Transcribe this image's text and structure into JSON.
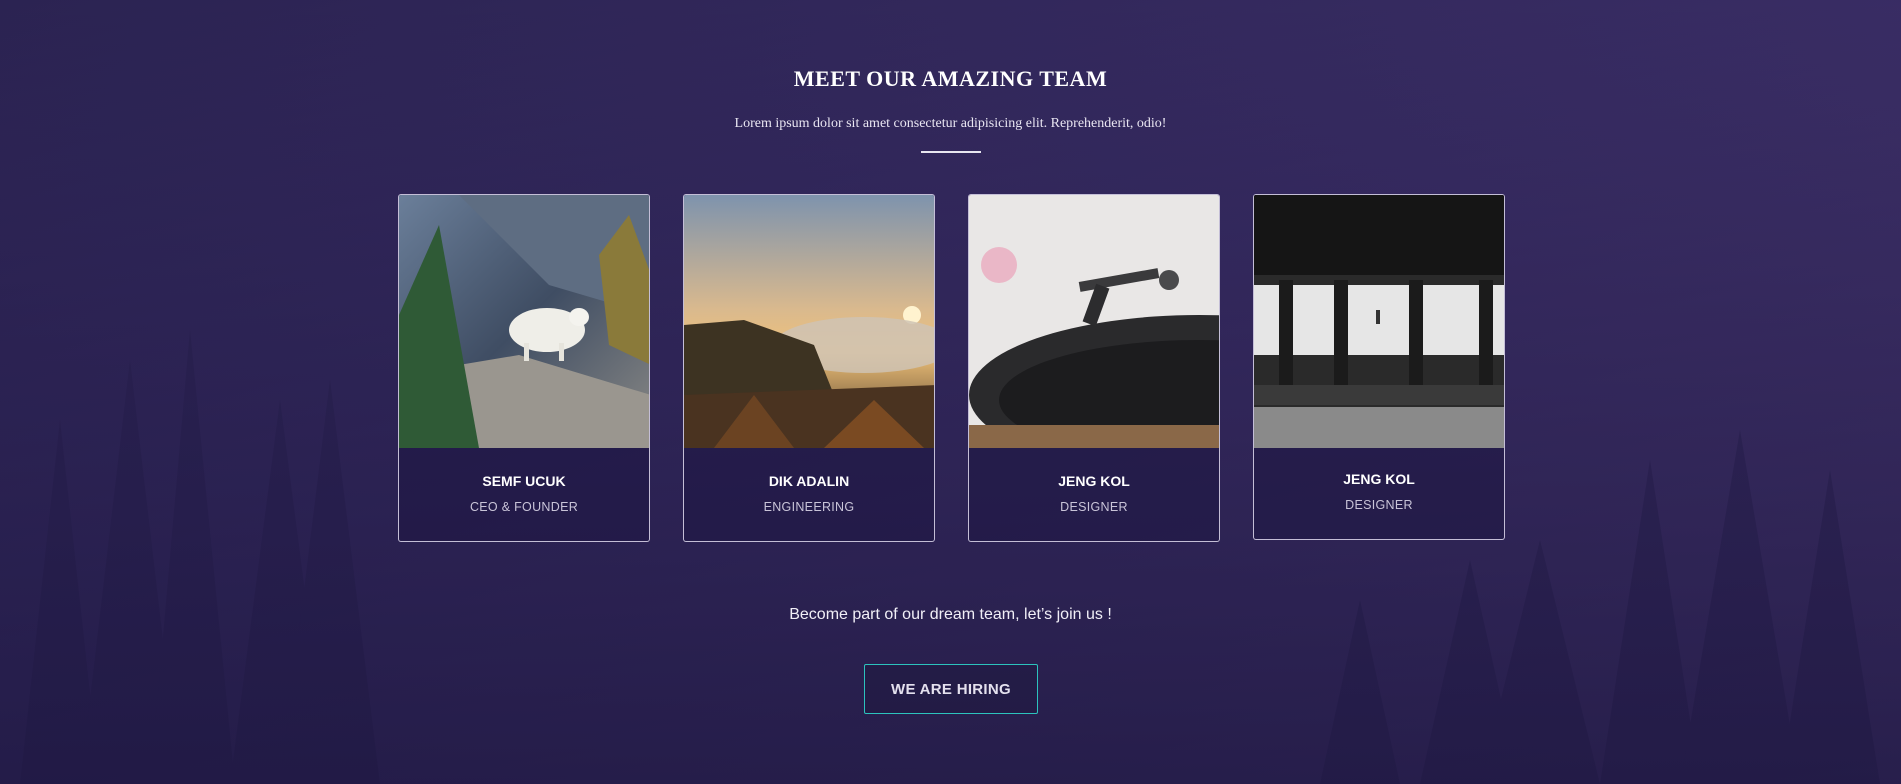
{
  "section": {
    "title": "MEET OUR AMAZING TEAM",
    "subtitle": "Lorem ipsum dolor sit amet consectetur adipisicing elit. Reprehenderit, odio!"
  },
  "team": [
    {
      "name": "SEMF UCUK",
      "role": "CEO & FOUNDER",
      "photo": "mountain-goat-photo"
    },
    {
      "name": "DIK ADALIN",
      "role": "ENGINEERING",
      "photo": "sunset-mountains-photo"
    },
    {
      "name": "JENG KOL",
      "role": "DESIGNER",
      "photo": "turntable-photo"
    },
    {
      "name": "JENG KOL",
      "role": "DESIGNER",
      "photo": "subway-platform-photo"
    }
  ],
  "cta": {
    "text": "Become part of our dream team, let’s join us !",
    "button_label": "WE ARE HIRING"
  },
  "colors": {
    "background": "#382c63",
    "accent_border": "#2cc3bd",
    "card_border": "#e1dcf0"
  }
}
